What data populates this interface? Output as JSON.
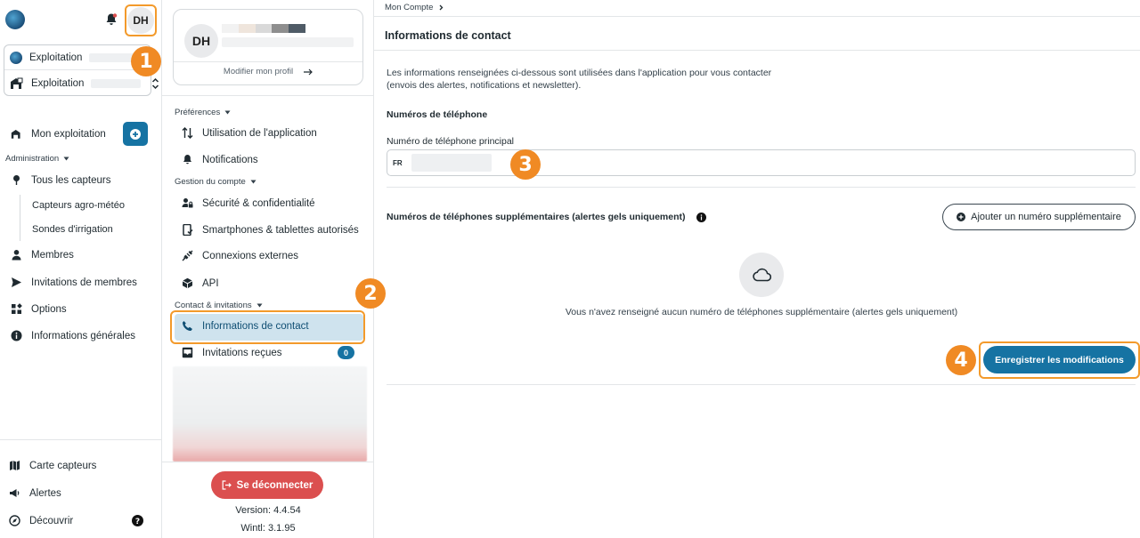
{
  "header": {
    "avatar_initials": "DH"
  },
  "farm_selector": {
    "primary_label": "Exploitation",
    "secondary_label": "Exploitation"
  },
  "sidebar": {
    "my_farm": "Mon exploitation",
    "admin_section": "Administration",
    "all_sensors": "Tous les capteurs",
    "agro_weather": "Capteurs agro-météo",
    "irrigation": "Sondes d'irrigation",
    "members": "Membres",
    "invitations": "Invitations de membres",
    "options": "Options",
    "general_info": "Informations générales",
    "map": "Carte capteurs",
    "alerts": "Alertes",
    "discover": "Découvrir"
  },
  "profile": {
    "initials": "DH",
    "edit_link": "Modifier mon profil"
  },
  "account_menu": {
    "preferences_section": "Préférences",
    "app_usage": "Utilisation de l'application",
    "notifications": "Notifications",
    "account_section": "Gestion du compte",
    "security": "Sécurité & confidentialité",
    "devices": "Smartphones & tablettes autorisés",
    "external": "Connexions externes",
    "api": "API",
    "contact_section": "Contact & invitations",
    "contact_info": "Informations de contact",
    "received_invitations": "Invitations reçues",
    "received_count": "0",
    "logout": "Se déconnecter",
    "version": "Version: 4.4.54",
    "wintl": "Wintl: 3.1.95"
  },
  "main": {
    "breadcrumb": "Mon Compte",
    "title": "Informations de contact",
    "intro_line1": "Les informations renseignées ci-dessous sont utilisées dans l'application pour vous contacter",
    "intro_line2": "(envois des alertes, notifications et newsletter).",
    "phones_heading": "Numéros de téléphone",
    "main_phone_label": "Numéro de téléphone principal",
    "country_code": "FR",
    "extra_heading": "Numéros de téléphones supplémentaires (alertes gels uniquement)",
    "add_button": "Ajouter un numéro supplémentaire",
    "empty_text": "Vous n'avez renseigné aucun numéro de téléphones supplémentaire (alertes gels uniquement)",
    "save_button": "Enregistrer les modifications"
  },
  "callouts": {
    "one": "1",
    "two": "2",
    "three": "3",
    "four": "4"
  },
  "colors": {
    "accent": "#1673a3",
    "callout": "#f08a24",
    "danger": "#db4f4f",
    "active_bg": "#cfe3ee"
  }
}
